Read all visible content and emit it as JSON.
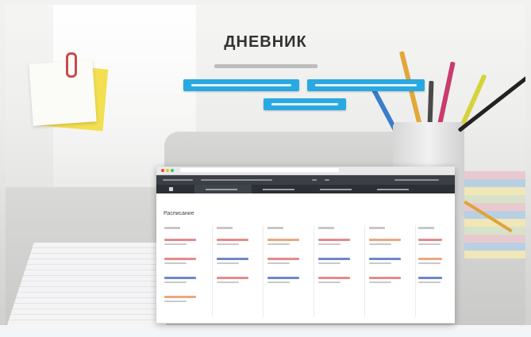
{
  "hero": {
    "title": "ДНЕВНИК"
  },
  "colors": {
    "accent": "#29a9e1",
    "app_dark": "#3b3f45",
    "lesson_red": "#e58a8a",
    "lesson_blue": "#6d87c9",
    "lesson_orange": "#e9a980"
  },
  "app": {
    "schedule_title": "Расписание"
  }
}
